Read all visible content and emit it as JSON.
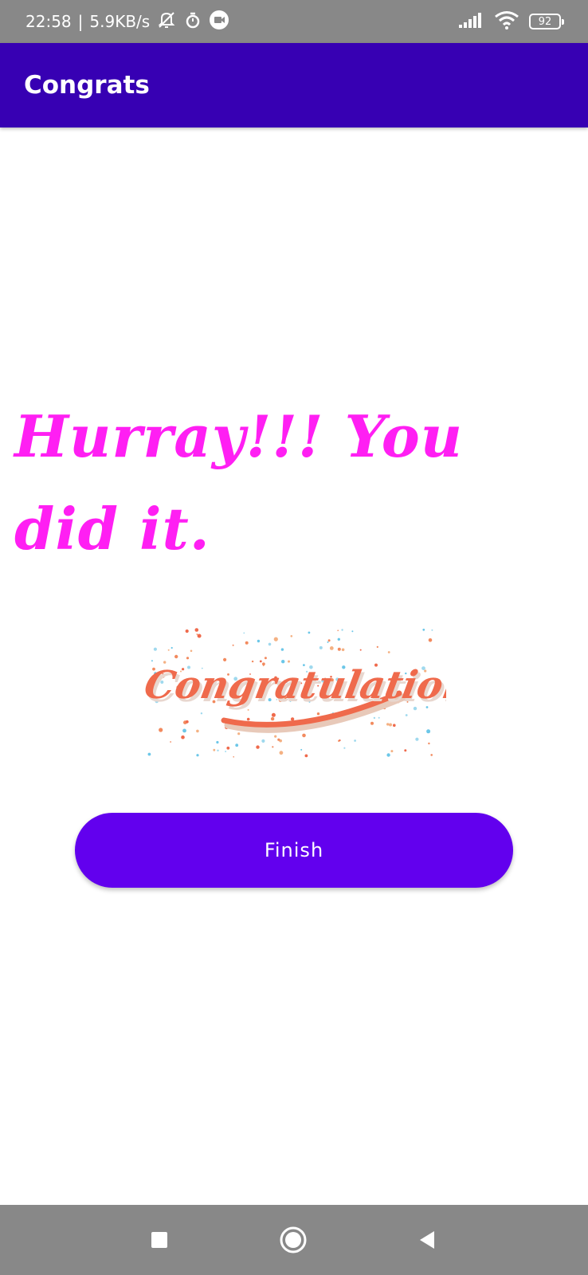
{
  "status_bar": {
    "time": "22:58",
    "separator": "|",
    "net_speed": "5.9KB/s",
    "battery": "92",
    "icons": [
      "bell-muted-icon",
      "timer-icon",
      "video-call-icon",
      "signal-icon",
      "wifi-icon",
      "battery-icon"
    ]
  },
  "app_bar": {
    "title": "Congrats",
    "color": "#3700b3"
  },
  "main": {
    "headline": "Hurray!!! You did it.",
    "headline_color": "#ff1ff3",
    "image": {
      "name": "congratulations-image",
      "text": "Congratulations!"
    },
    "finish_button": {
      "label": "Finish",
      "color": "#6200ee"
    }
  },
  "nav_bar": {
    "icons": [
      "recents-square-icon",
      "home-circle-icon",
      "back-triangle-icon"
    ]
  }
}
